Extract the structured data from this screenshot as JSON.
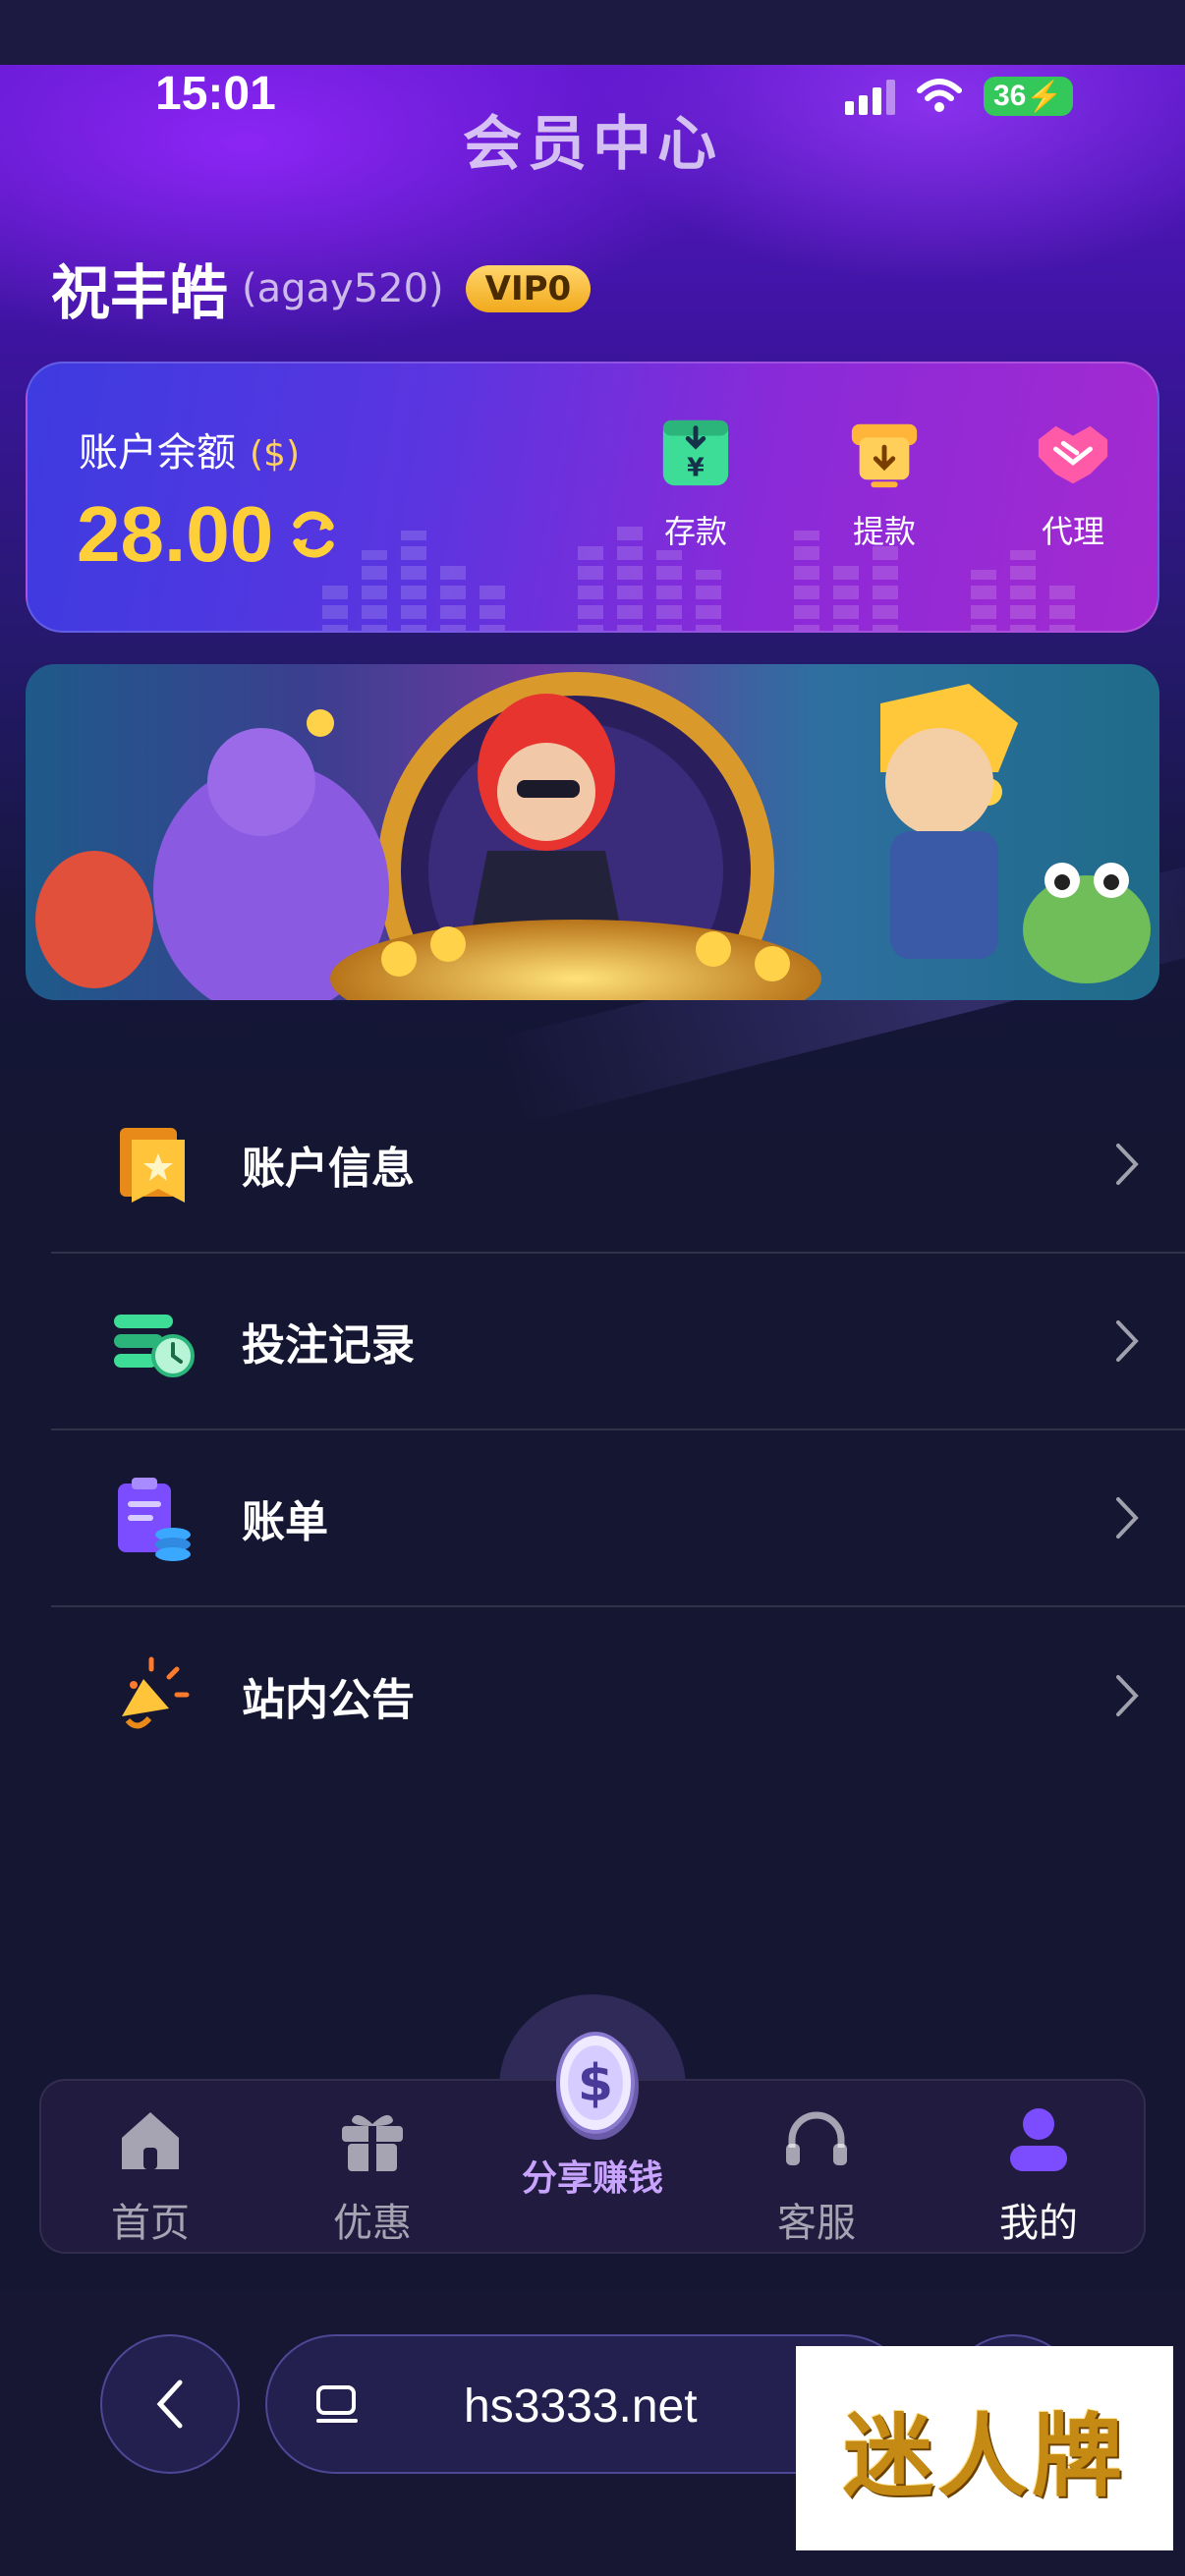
{
  "status_bar": {
    "time": "15:01",
    "battery": "36"
  },
  "header": {
    "title": "会员中心"
  },
  "user": {
    "name": "祝丰皓",
    "id": "(agay520)",
    "vip": "VIP0"
  },
  "balance": {
    "label": "账户余额",
    "unit": "($)",
    "amount": "28.00",
    "actions": [
      {
        "label": "存款",
        "icon": "deposit-icon",
        "color": "#3ddc97"
      },
      {
        "label": "提款",
        "icon": "withdraw-icon",
        "color": "#ffb53a"
      },
      {
        "label": "代理",
        "icon": "handshake-icon",
        "color": "#ff5aa8"
      }
    ]
  },
  "menu": [
    {
      "label": "账户信息",
      "icon": "account-info-icon"
    },
    {
      "label": "投注记录",
      "icon": "bet-record-icon"
    },
    {
      "label": "账单",
      "icon": "bill-icon"
    },
    {
      "label": "站内公告",
      "icon": "announcement-icon"
    }
  ],
  "tabs": [
    {
      "label": "首页",
      "icon": "home-icon"
    },
    {
      "label": "优惠",
      "icon": "gift-icon"
    },
    {
      "label": "分享赚钱",
      "icon": "coin-icon"
    },
    {
      "label": "客服",
      "icon": "headset-icon"
    },
    {
      "label": "我的",
      "icon": "user-icon",
      "active": true
    }
  ],
  "browser": {
    "url": "hs3333.net"
  },
  "watermark": {
    "text": "迷人牌"
  },
  "colors": {
    "accent": "#ffcf3a",
    "active_tab": "#7b4dff",
    "share_label": "#c9a4ff"
  }
}
